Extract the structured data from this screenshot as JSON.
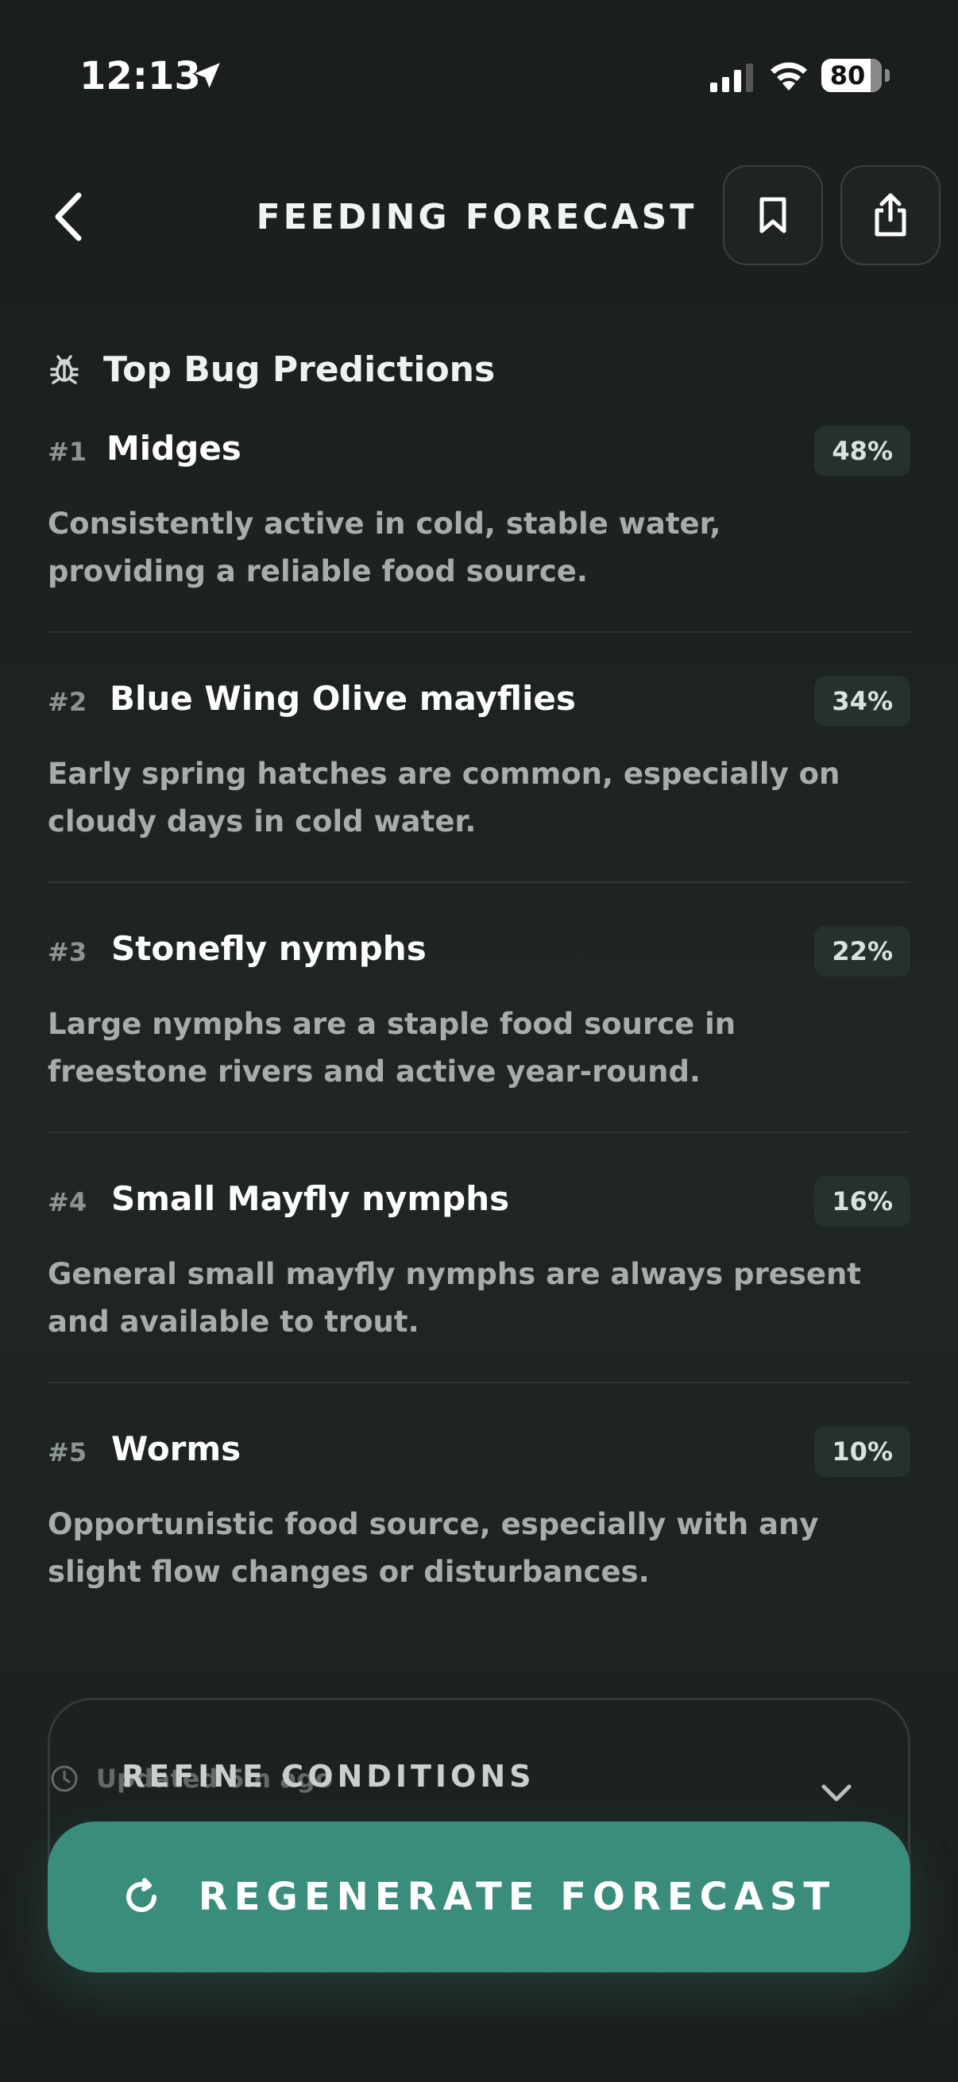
{
  "status_bar": {
    "time": "12:13",
    "battery": "80"
  },
  "nav": {
    "title": "FEEDING FORECAST"
  },
  "section": {
    "title": "Top Bug Predictions"
  },
  "predictions": [
    {
      "rank": "#1",
      "name": "Midges",
      "percent": "48%",
      "description_line1": "Consistently active in cold, stable water,",
      "description_line2": "providing a reliable food source."
    },
    {
      "rank": "#2",
      "name": "Blue Wing Olive mayflies",
      "percent": "34%",
      "description_line1": "Early spring hatches are common, especially on",
      "description_line2": "cloudy days in cold water."
    },
    {
      "rank": "#3",
      "name": "Stonefly nymphs",
      "percent": "22%",
      "description_line1": "Large nymphs are a staple food source in",
      "description_line2": "freestone rivers and active year-round."
    },
    {
      "rank": "#4",
      "name": "Small Mayfly nymphs",
      "percent": "16%",
      "description_line1": "General small mayfly nymphs are always present",
      "description_line2": "and available to trout."
    },
    {
      "rank": "#5",
      "name": "Worms",
      "percent": "10%",
      "description_line1": "Opportunistic food source, especially with any",
      "description_line2": "slight flow changes or disturbances."
    }
  ],
  "refine": {
    "title": "REFINE CONDITIONS",
    "updated": "Updated 5m ago"
  },
  "regenerate": {
    "label": "REGENERATE FORECAST"
  },
  "colors": {
    "accent": "#3a8c7b",
    "background": "#1d2321",
    "muted_text": "#a7adab"
  }
}
